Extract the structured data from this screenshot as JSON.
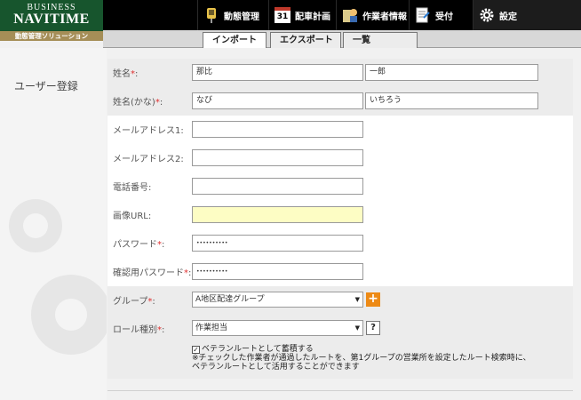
{
  "logo": {
    "line1": "BUSINESS",
    "line2": "NAVITIME",
    "subtitle": "動態管理ソリューション"
  },
  "nav": [
    {
      "label": "動態管理",
      "icon": "pin-icon"
    },
    {
      "label": "配車計画",
      "icon": "calendar-icon",
      "icon_text": "31"
    },
    {
      "label": "作業者情報",
      "icon": "worker-icon"
    },
    {
      "label": "受付",
      "icon": "document-icon"
    },
    {
      "label": "設定",
      "icon": "gear-icon"
    }
  ],
  "tabs": [
    {
      "label": "インポート"
    },
    {
      "label": "エクスポート"
    },
    {
      "label": "一覧"
    }
  ],
  "page": {
    "title": "ユーザー登録"
  },
  "form": {
    "required_mark": "*",
    "name": {
      "label": "姓名",
      "last": "那比",
      "first": "一郎"
    },
    "kana": {
      "label": "姓名(かな)",
      "last": "なび",
      "first": "いちろう"
    },
    "email1": {
      "label": "メールアドレス1:",
      "value": ""
    },
    "email2": {
      "label": "メールアドレス2:",
      "value": ""
    },
    "phone": {
      "label": "電話番号:",
      "value": ""
    },
    "image_url": {
      "label": "画像URL:",
      "value": ""
    },
    "password": {
      "label": "パスワード",
      "value": "••••••••••"
    },
    "confirm": {
      "label": "確認用パスワード",
      "value": "••••••••••"
    },
    "group": {
      "label": "グループ",
      "selected": "A地区配達グループ"
    },
    "role": {
      "label": "ロール種別",
      "selected": "作業担当"
    },
    "veteran": {
      "checked": true,
      "label": "ベテランルートとして蓄積する",
      "note1": "※チェックした作業者が通過したルートを、第1グループの営業所を設定したルート検索時に、",
      "note2": "ベテランルートとして活用することができます"
    }
  },
  "colors": {
    "header_bg": "#000000",
    "logo_green": "#17552d",
    "logo_gold": "#a58e57",
    "required": "#e03030",
    "add_button": "#ed8a16",
    "highlight_input": "#fdfdc4"
  }
}
